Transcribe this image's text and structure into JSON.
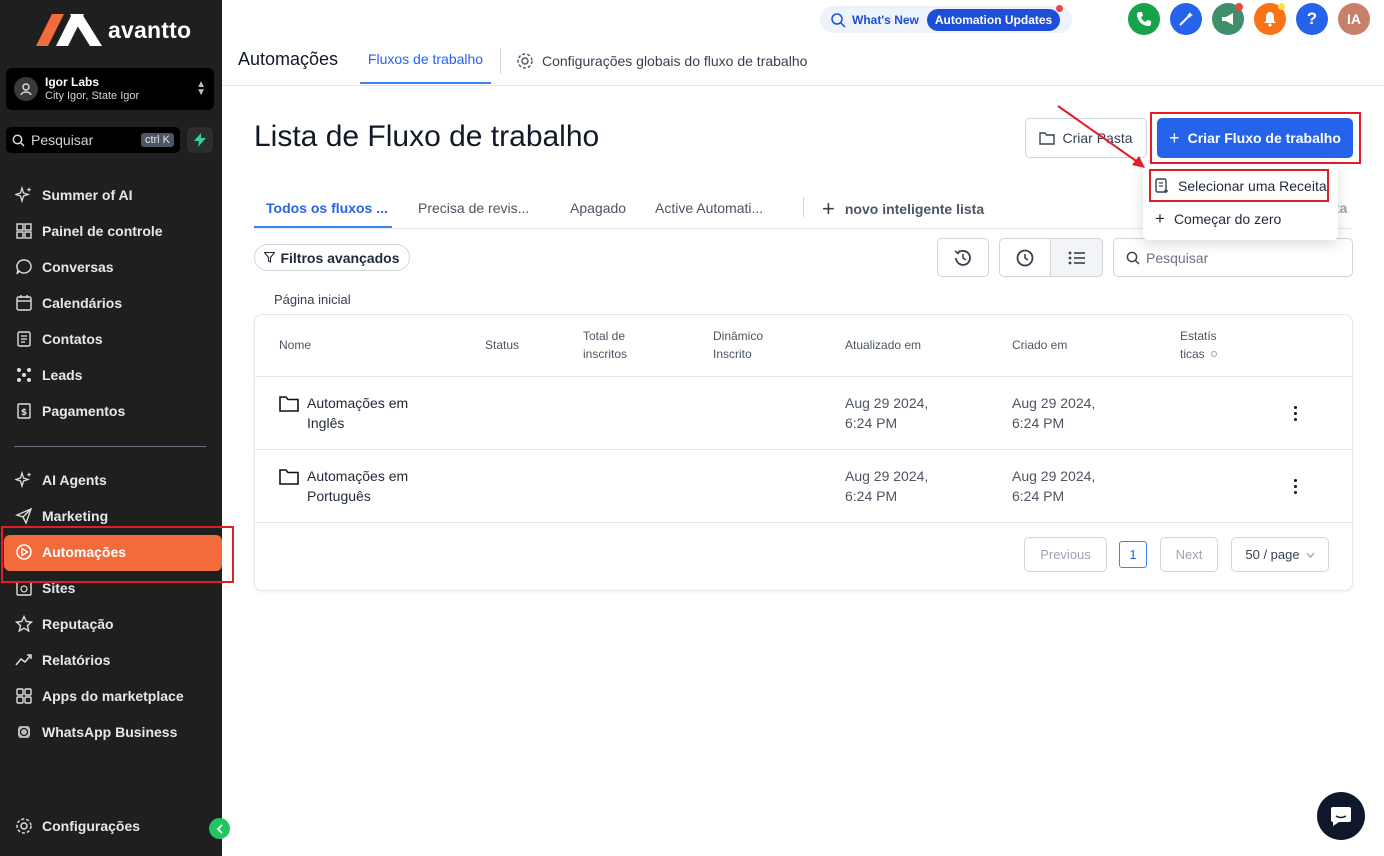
{
  "brand": {
    "name": "avantto"
  },
  "account": {
    "name": "Igor Labs",
    "location": "City Igor, State Igor"
  },
  "sidebar_search": {
    "placeholder": "Pesquisar",
    "shortcut": "ctrl K"
  },
  "sidebar": {
    "items_top": [
      {
        "label": "Summer of AI",
        "icon": "sparkles-icon"
      },
      {
        "label": "Painel de controle",
        "icon": "dashboard-grid-icon"
      },
      {
        "label": "Conversas",
        "icon": "chat-bubble-icon"
      },
      {
        "label": "Calendários",
        "icon": "calendar-icon"
      },
      {
        "label": "Contatos",
        "icon": "contacts-icon"
      },
      {
        "label": "Leads",
        "icon": "leads-icon"
      },
      {
        "label": "Pagamentos",
        "icon": "payments-icon"
      }
    ],
    "items_bottom": [
      {
        "label": "AI Agents",
        "icon": "sparkles-icon"
      },
      {
        "label": "Marketing",
        "icon": "send-icon"
      },
      {
        "label": "Automações",
        "icon": "automation-icon",
        "active": true
      },
      {
        "label": "Sites",
        "icon": "globe-icon"
      },
      {
        "label": "Reputação",
        "icon": "star-icon"
      },
      {
        "label": "Relatórios",
        "icon": "trend-icon"
      },
      {
        "label": "Apps do marketplace",
        "icon": "apps-grid-icon"
      },
      {
        "label": "WhatsApp Business",
        "icon": "whatsapp-icon"
      }
    ],
    "settings_label": "Configurações"
  },
  "topbar": {
    "whats_new": "What's New",
    "updates_badge": "Automation Updates",
    "avatar_initials": "IA",
    "help": "?"
  },
  "header": {
    "section": "Automações",
    "tab_flows": "Fluxos de trabalho",
    "tab_global": "Configurações globais do fluxo de trabalho"
  },
  "main": {
    "title": "Lista de Fluxo de trabalho",
    "create_folder": "Criar Pasta",
    "create_flow": "Criar Fluxo de trabalho",
    "dropdown": {
      "recipe": "Selecionar uma Receita",
      "scratch": "Começar do zero"
    },
    "tabs": [
      "Todos os fluxos ...",
      "Precisa de revis...",
      "Apagado",
      "Active Automati..."
    ],
    "new_smart_list": "novo inteligente lista",
    "faded_tab": "sta",
    "filters": "Filtros avançados",
    "search_placeholder": "Pesquisar",
    "breadcrumb": "Página inicial"
  },
  "table": {
    "headers": {
      "name": "Nome",
      "status": "Status",
      "total_1": "Total de",
      "total_2": "inscritos",
      "dyn_1": "Dinâmico",
      "dyn_2": "Inscrito",
      "updated": "Atualizado em",
      "created": "Criado em",
      "stats_1": "Estatís",
      "stats_2": "ticas"
    },
    "rows": [
      {
        "name_1": "Automações em",
        "name_2": "Inglês",
        "updated_1": "Aug 29 2024,",
        "updated_2": "6:24 PM",
        "created_1": "Aug 29 2024,",
        "created_2": "6:24 PM"
      },
      {
        "name_1": "Automações em",
        "name_2": "Português",
        "updated_1": "Aug 29 2024,",
        "updated_2": "6:24 PM",
        "created_1": "Aug 29 2024,",
        "created_2": "6:24 PM"
      }
    ],
    "pagination": {
      "previous": "Previous",
      "page": "1",
      "next": "Next",
      "per_page": "50 / page"
    }
  },
  "colors": {
    "accent": "#2563eb",
    "active_nav": "#f26b3a",
    "sidebar_bg": "#1f1f1f",
    "highlight": "#e11d2a"
  }
}
